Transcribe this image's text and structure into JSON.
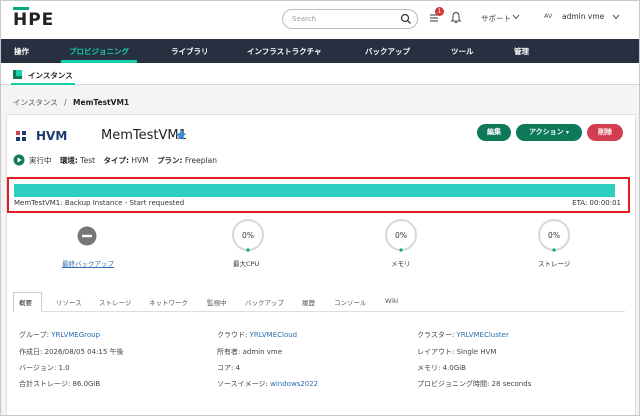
{
  "header": {
    "logo": "HPE",
    "search_placeholder": "Search",
    "tasks_badge": "1",
    "support_label": "サポート",
    "avatar_initials": "AV",
    "user_name": "admin vme"
  },
  "nav": {
    "items": [
      "操作",
      "プロビジョニング",
      "ライブラリ",
      "インフラストラクチャ",
      "バックアップ",
      "ツール",
      "管理"
    ],
    "active_index": 1
  },
  "subnav": {
    "label": "インスタンス"
  },
  "breadcrumb": {
    "parent": "インスタンス",
    "separator": "/",
    "current": "MemTestVM1"
  },
  "instance": {
    "hypervisor_label": "HVM",
    "name": "MemTestVM1",
    "actions": {
      "edit": "編集",
      "action": "アクション",
      "delete": "削除"
    },
    "status": "実行中",
    "env_key": "環境:",
    "env_value": "Test",
    "type_key": "タイプ:",
    "type_value": "HVM",
    "plan_key": "プラン:",
    "plan_value": "Freeplan"
  },
  "progress": {
    "label": "MemTestVM1: Backup Instance - Start requested",
    "eta": "ETA: 00:00:01",
    "fraction": 1.0
  },
  "stats": [
    {
      "label": "最終バックアップ",
      "value": ""
    },
    {
      "label": "最大CPU",
      "value": "0%"
    },
    {
      "label": "メモリ",
      "value": "0%"
    },
    {
      "label": "ストレージ",
      "value": "0%"
    }
  ],
  "tabs": [
    "概要",
    "リソース",
    "ストレージ",
    "ネットワーク",
    "監視中",
    "バックアップ",
    "履歴",
    "コンソール",
    "Wiki"
  ],
  "details": {
    "group_key": "グループ:",
    "group_value": "YRLVMEGroup",
    "created_key": "作成日:",
    "created_value": "2026/08/05 04:15 午後",
    "version_key": "バージョン:",
    "version_value": "1.0",
    "total_storage_key": "合計ストレージ:",
    "total_storage_value": "86.0GiB",
    "cloud_key": "クラウド:",
    "cloud_value": "YRLVMECloud",
    "owner_key": "所有者:",
    "owner_value": "admin vme",
    "cores_key": "コア:",
    "cores_value": "4",
    "source_key": "ソースイメージ:",
    "source_value": "windows2022",
    "cluster_key": "クラスター:",
    "cluster_value": "YRLVMECluster",
    "layout_key": "レイアウト:",
    "layout_value": "Single HVM",
    "memory_key": "メモリ:",
    "memory_value": "4.0GiB",
    "prov_time_key": "プロビジョニング時間:",
    "prov_time_value": "28 seconds"
  },
  "colors": {
    "nav_bg": "#263040",
    "accent": "#17d0a9",
    "primary_button": "#0f7a5a",
    "danger_button": "#d23d4f",
    "progress_fill": "#2ccfc0",
    "highlight_border": "#e31b23",
    "link": "#2b6cb0"
  }
}
